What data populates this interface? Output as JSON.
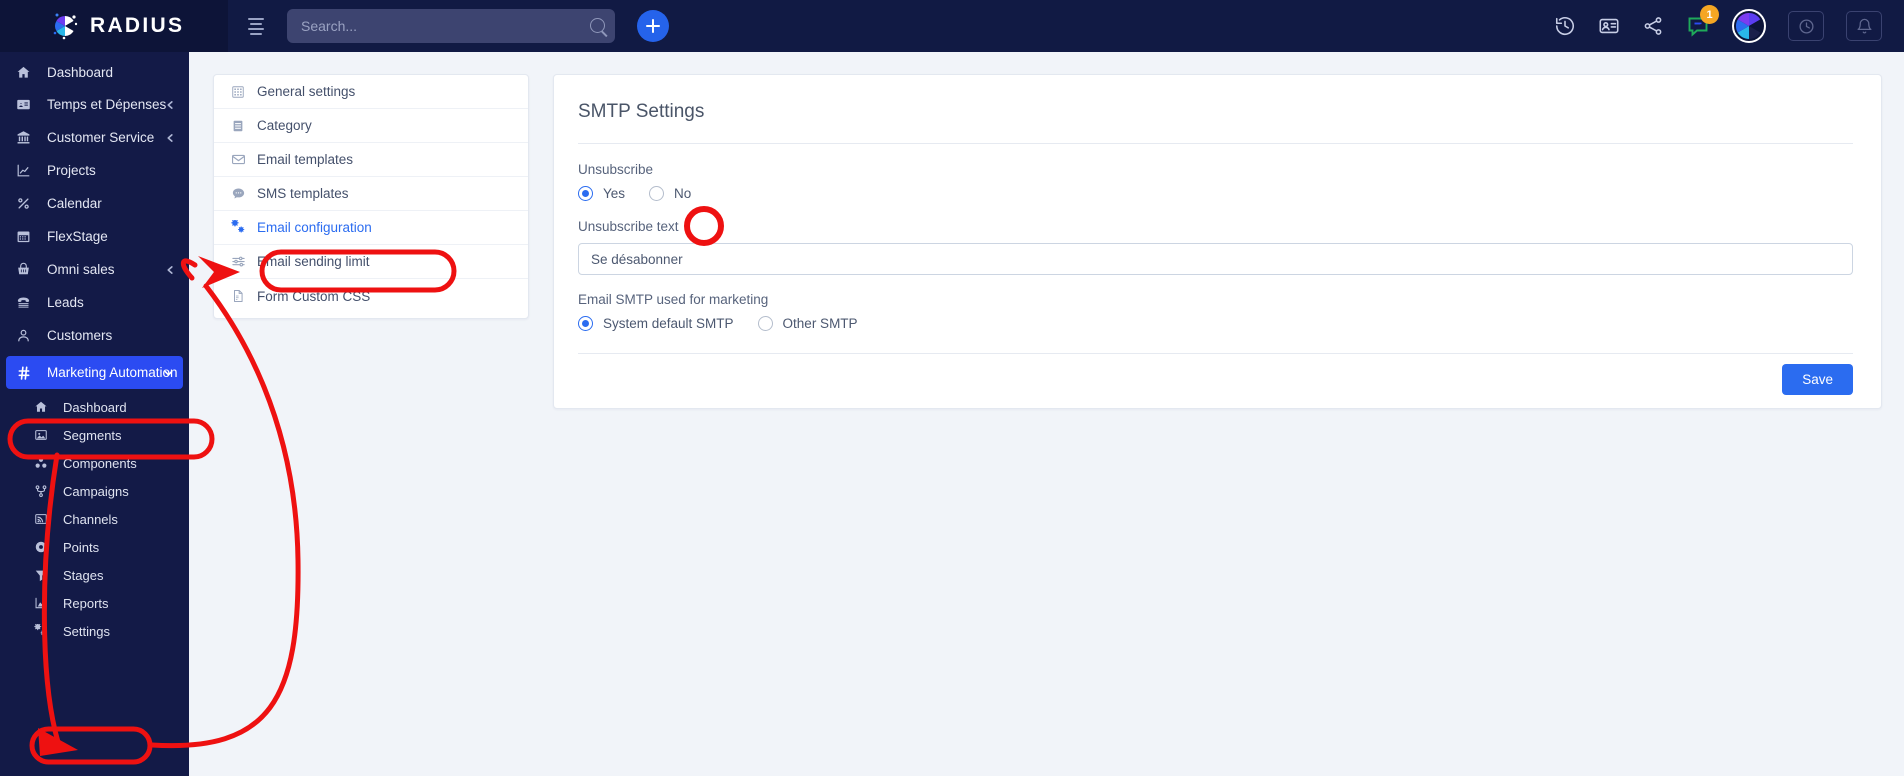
{
  "app": {
    "brand_name": "RADIUS",
    "accent_blue": "#2b6cf0",
    "sidebar_bg": "#131a47",
    "topbar_bg": "#111a44",
    "annotation_color": "#ee1111"
  },
  "topbar": {
    "menu_toggle_name": "hamburger-menu",
    "search_placeholder": "Search...",
    "search_value": "",
    "add_button_label": "+",
    "chat_badge_count": "1",
    "icons": [
      "history-icon",
      "contact-card-icon",
      "share-icon",
      "chat-notification-icon",
      "user-avatar",
      "clock-icon",
      "bell-icon"
    ]
  },
  "sidebar": {
    "items": [
      {
        "label": "Dashboard",
        "icon": "home-icon",
        "chevron": false,
        "active": false
      },
      {
        "label": "Temps et Dépenses",
        "icon": "id-card-icon",
        "chevron": true,
        "active": false
      },
      {
        "label": "Customer Service",
        "icon": "bank-icon",
        "chevron": true,
        "active": false
      },
      {
        "label": "Projects",
        "icon": "chart-icon",
        "chevron": false,
        "active": false
      },
      {
        "label": "Calendar",
        "icon": "percent-icon",
        "chevron": false,
        "active": false
      },
      {
        "label": "FlexStage",
        "icon": "calendar-icon",
        "chevron": false,
        "active": false
      },
      {
        "label": "Omni sales",
        "icon": "basket-icon",
        "chevron": true,
        "active": false
      },
      {
        "label": "Leads",
        "icon": "phone-icon",
        "chevron": false,
        "active": false
      },
      {
        "label": "Customers",
        "icon": "person-icon",
        "chevron": false,
        "active": false
      },
      {
        "label": "Marketing Automation",
        "icon": "hash-icon",
        "chevron": true,
        "active": true
      }
    ],
    "sub_items": [
      {
        "label": "Dashboard",
        "icon": "home-icon"
      },
      {
        "label": "Segments",
        "icon": "segments-icon"
      },
      {
        "label": "Components",
        "icon": "components-icon"
      },
      {
        "label": "Campaigns",
        "icon": "campaigns-icon"
      },
      {
        "label": "Channels",
        "icon": "rss-icon"
      },
      {
        "label": "Points",
        "icon": "points-icon"
      },
      {
        "label": "Stages",
        "icon": "funnel-icon"
      },
      {
        "label": "Reports",
        "icon": "reports-icon"
      },
      {
        "label": "Settings",
        "icon": "gears-icon"
      }
    ]
  },
  "settings_menu": {
    "items": [
      {
        "label": "General settings",
        "icon": "grid-icon",
        "selected": false
      },
      {
        "label": "Category",
        "icon": "list-icon",
        "selected": false
      },
      {
        "label": "Email templates",
        "icon": "envelope-icon",
        "selected": false
      },
      {
        "label": "SMS templates",
        "icon": "chat-bubble-icon",
        "selected": false
      },
      {
        "label": "Email configuration",
        "icon": "gears-icon",
        "selected": true
      },
      {
        "label": "Email sending limit",
        "icon": "sliders-icon",
        "selected": false
      },
      {
        "label": "Form Custom CSS",
        "icon": "css-file-icon",
        "selected": false
      }
    ]
  },
  "smtp_panel": {
    "title": "SMTP Settings",
    "unsubscribe_label": "Unsubscribe",
    "unsubscribe_yes": "Yes",
    "unsubscribe_no": "No",
    "unsubscribe_selected": "Yes",
    "unsubscribe_text_label": "Unsubscribe text",
    "unsubscribe_text_value": "Se désabonner",
    "smtp_label": "Email SMTP used for marketing",
    "smtp_option_default": "System default SMTP",
    "smtp_option_other": "Other SMTP",
    "smtp_selected": "System default SMTP",
    "save_label": "Save"
  },
  "annotations": {
    "marketing_automation_highlight": "rounded-rect around Marketing Automation nav item",
    "settings_highlight": "rounded-rect around Settings sub nav item",
    "email_configuration_highlight": "rounded-rect around Email configuration menu row",
    "unsubscribe_yes_highlight": "circle around Yes radio button",
    "arrow_settings_to_email_config": "curved arrow from Settings to Email configuration"
  }
}
